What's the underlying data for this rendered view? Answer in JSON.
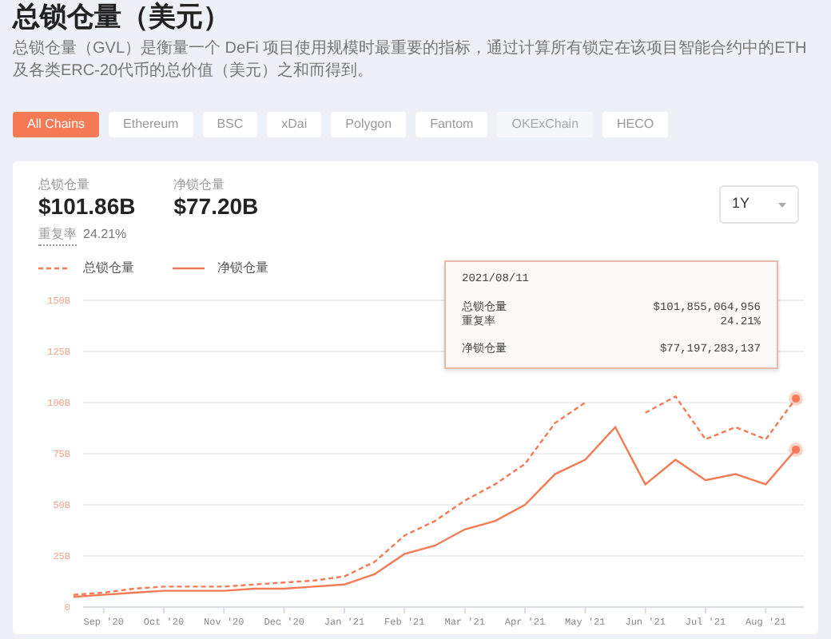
{
  "title": "总锁仓量（美元）",
  "description": "总锁仓量（GVL）是衡量一个 DeFi 项目使用规模时最重要的指标，通过计算所有锁定在该项目智能合约中的ETH及各类ERC-20代币的总价值（美元）之和而得到。",
  "chains": [
    {
      "label": "All Chains",
      "selected": true,
      "disabled": false
    },
    {
      "label": "Ethereum",
      "selected": false,
      "disabled": false
    },
    {
      "label": "BSC",
      "selected": false,
      "disabled": false
    },
    {
      "label": "xDai",
      "selected": false,
      "disabled": false
    },
    {
      "label": "Polygon",
      "selected": false,
      "disabled": false
    },
    {
      "label": "Fantom",
      "selected": false,
      "disabled": false
    },
    {
      "label": "OKExChain",
      "selected": false,
      "disabled": true
    },
    {
      "label": "HECO",
      "selected": false,
      "disabled": false
    }
  ],
  "stats": [
    {
      "label": "总锁仓量",
      "value": "$101.86B"
    },
    {
      "label": "净锁仓量",
      "value": "$77.20B"
    }
  ],
  "overlap": {
    "label": "重复率",
    "value": "24.21%"
  },
  "range_select": {
    "value": "1Y"
  },
  "chart_data": {
    "type": "line",
    "categories": [
      null,
      "Sep '20",
      null,
      "Oct '20",
      null,
      "Nov '20",
      null,
      "Dec '20",
      null,
      "Jan '21",
      null,
      "Feb '21",
      null,
      "Mar '21",
      null,
      "Apr '21",
      null,
      "May '21",
      null,
      "Jun '21",
      null,
      "Jul '21",
      null,
      "Aug '21",
      null
    ],
    "series": [
      {
        "name": "总锁仓量",
        "color": "#f47a55",
        "line_style": "dashed",
        "values": [
          6,
          7,
          9,
          10,
          10,
          10,
          11,
          12,
          13,
          15,
          22,
          35,
          42,
          52,
          60,
          70,
          90,
          100,
          null,
          95,
          103,
          82,
          88,
          82,
          102
        ]
      },
      {
        "name": "净锁仓量",
        "color": "#f47a55",
        "line_style": "solid",
        "values": [
          5,
          6,
          7,
          8,
          8,
          8,
          9,
          9,
          10,
          11,
          16,
          26,
          30,
          38,
          42,
          50,
          65,
          72,
          88,
          60,
          72,
          62,
          65,
          60,
          77
        ]
      }
    ],
    "ylim": [
      0,
      150
    ],
    "grid": true,
    "yticks": [
      {
        "value": 0,
        "label": "0"
      },
      {
        "value": 25,
        "label": "25B"
      },
      {
        "value": 50,
        "label": "50B"
      },
      {
        "value": 75,
        "label": "75B"
      },
      {
        "value": 100,
        "label": "100B"
      },
      {
        "value": 125,
        "label": "125B"
      },
      {
        "value": 150,
        "label": "150B"
      }
    ]
  },
  "tooltip": {
    "date": "2021/08/11",
    "rows": [
      {
        "label": "总锁仓量",
        "value": "$101,855,064,956"
      },
      {
        "label": "重复率",
        "value": "24.21%"
      },
      {
        "label": "净锁仓量",
        "value": "$77,197,283,137"
      }
    ]
  }
}
